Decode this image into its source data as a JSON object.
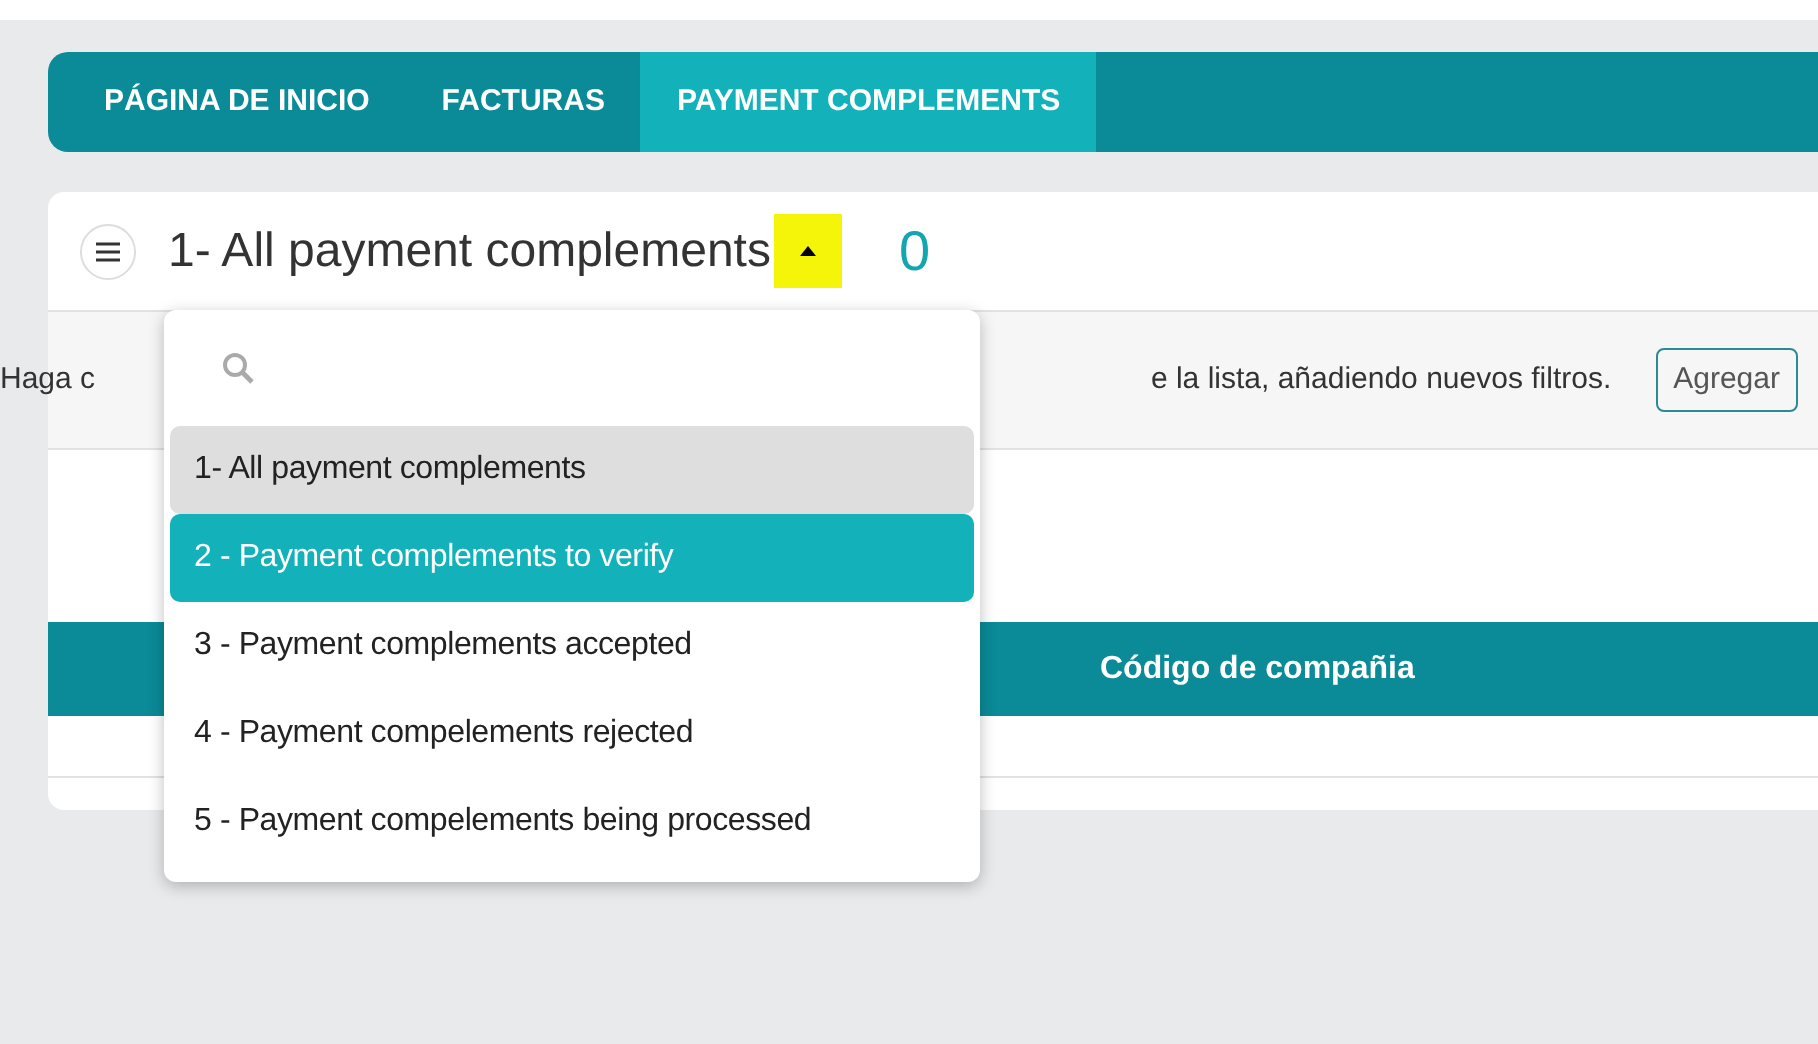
{
  "tabs": [
    {
      "label": "PÁGINA DE INICIO",
      "selected": false
    },
    {
      "label": "FACTURAS",
      "selected": false
    },
    {
      "label": "PAYMENT COMPLEMENTS",
      "selected": true
    }
  ],
  "view": {
    "title": "1- All payment complements",
    "count": "0",
    "dropdown_open": true
  },
  "filter_bar": {
    "text_start": "Haga c",
    "text_end": "e la lista, añadiendo nuevos filtros.",
    "button": "Agregar"
  },
  "table": {
    "columns": [
      "Código de compañia"
    ]
  },
  "dropdown": {
    "items": [
      {
        "label": "1- All payment complements",
        "selected": true,
        "highlighted": false
      },
      {
        "label": "2 - Payment complements to verify",
        "selected": false,
        "highlighted": true
      },
      {
        "label": "3 - Payment complements accepted",
        "selected": false,
        "highlighted": false
      },
      {
        "label": "4 - Payment compelements rejected",
        "selected": false,
        "highlighted": false
      },
      {
        "label": "5 - Payment compelements being processed",
        "selected": false,
        "highlighted": false
      }
    ]
  }
}
